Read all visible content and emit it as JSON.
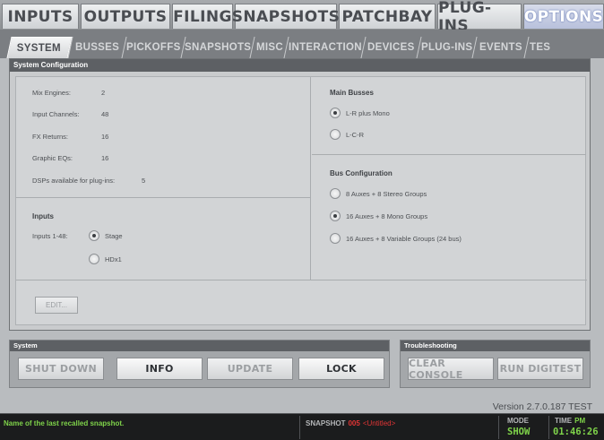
{
  "top_tabs": [
    "INPUTS",
    "OUTPUTS",
    "FILING",
    "SNAPSHOTS",
    "PATCHBAY",
    "PLUG-INS",
    "OPTIONS"
  ],
  "sub_tabs": [
    "SYSTEM",
    "BUSSES",
    "PICKOFFS",
    "SNAPSHOTS",
    "MISC",
    "INTERACTION",
    "DEVICES",
    "PLUG-INS",
    "EVENTS",
    "TES"
  ],
  "system_config": {
    "header": "System Configuration",
    "stats": [
      {
        "label": "Mix Engines:",
        "value": "2"
      },
      {
        "label": "Input Channels:",
        "value": "48"
      },
      {
        "label": "FX Returns:",
        "value": "16"
      },
      {
        "label": "Graphic EQs:",
        "value": "16"
      },
      {
        "label": "DSPs available for plug-ins:",
        "value": "5"
      }
    ],
    "inputs": {
      "title": "Inputs",
      "label": "Inputs 1-48:",
      "options": [
        "Stage",
        "HDx1"
      ],
      "selected": "Stage"
    },
    "main_busses": {
      "title": "Main Busses",
      "options": [
        "L-R plus Mono",
        "L-C-R"
      ],
      "selected": "L-R plus Mono"
    },
    "bus_configuration": {
      "title": "Bus Configuration",
      "options": [
        "8 Auxes + 8 Stereo Groups",
        "16 Auxes + 8 Mono Groups",
        "16 Auxes + 8 Variable Groups (24 bus)"
      ],
      "selected": "16 Auxes + 8 Mono Groups"
    },
    "edit_label": "EDIT..."
  },
  "system_group": {
    "header": "System",
    "buttons": [
      "SHUT DOWN",
      "INFO",
      "UPDATE",
      "LOCK"
    ]
  },
  "troubleshooting_group": {
    "header": "Troubleshooting",
    "buttons": [
      "CLEAR CONSOLE",
      "RUN DIGITEST"
    ]
  },
  "version": "Version 2.7.0.187 TEST",
  "status": {
    "message": "Name of the last recalled snapshot.",
    "snapshot_label": "SNAPSHOT",
    "snapshot_number": "005",
    "snapshot_name": "<Untitled>",
    "mode_label": "MODE",
    "mode_value": "SHOW",
    "time_label": "TIME",
    "ampm": "PM",
    "time_value": "01:46:26"
  },
  "colors": {
    "status_green": "#7fd34a",
    "snapshot_red": "#e23535",
    "active_tab_glow": "#6b7fb8"
  }
}
